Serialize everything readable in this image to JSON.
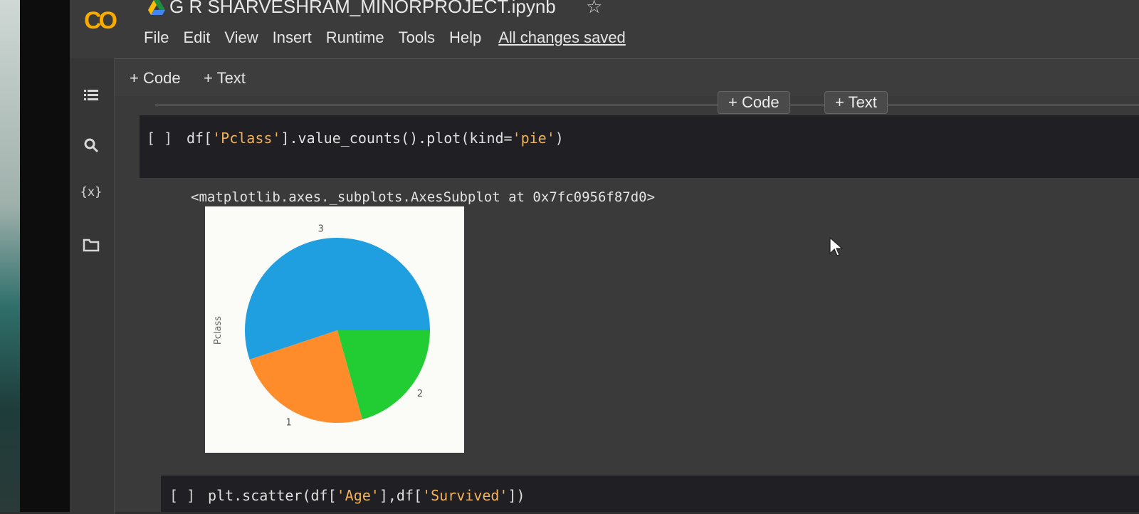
{
  "header": {
    "logo_text": "CO",
    "title": "G R SHARVESHRAM_MINORPROJECT.ipynb",
    "star": "☆",
    "menu": [
      "File",
      "Edit",
      "View",
      "Insert",
      "Runtime",
      "Tools",
      "Help"
    ],
    "save_status": "All changes saved"
  },
  "toolbar": {
    "add_code": "+ Code",
    "add_text": "+ Text"
  },
  "floating": {
    "add_code": "+ Code",
    "add_text": "+ Text"
  },
  "rail": {
    "icons": [
      "menu-icon",
      "search-icon",
      "variables-icon",
      "folder-icon"
    ],
    "variables_glyph": "{x}"
  },
  "cells": [
    {
      "run": "[ ]",
      "code_prefix": "df[",
      "code_str1": "'Pclass'",
      "code_mid": "].value_counts().plot(kind=",
      "code_str2": "'pie'",
      "code_suffix": ")"
    },
    {
      "run": "[ ]",
      "code_prefix": "plt.scatter(df[",
      "code_str1": "'Age'",
      "code_mid": "],df[",
      "code_str2": "'Survived'",
      "code_suffix": "])"
    }
  ],
  "output": {
    "repr": "<matplotlib.axes._subplots.AxesSubplot at 0x7fc0956f87d0>"
  },
  "chart_data": {
    "type": "pie",
    "ylabel": "Pclass",
    "categories": [
      "3",
      "1",
      "2"
    ],
    "values": [
      491,
      216,
      184
    ],
    "colors": [
      "#1f9fe0",
      "#ff8c2a",
      "#22cc33"
    ]
  }
}
